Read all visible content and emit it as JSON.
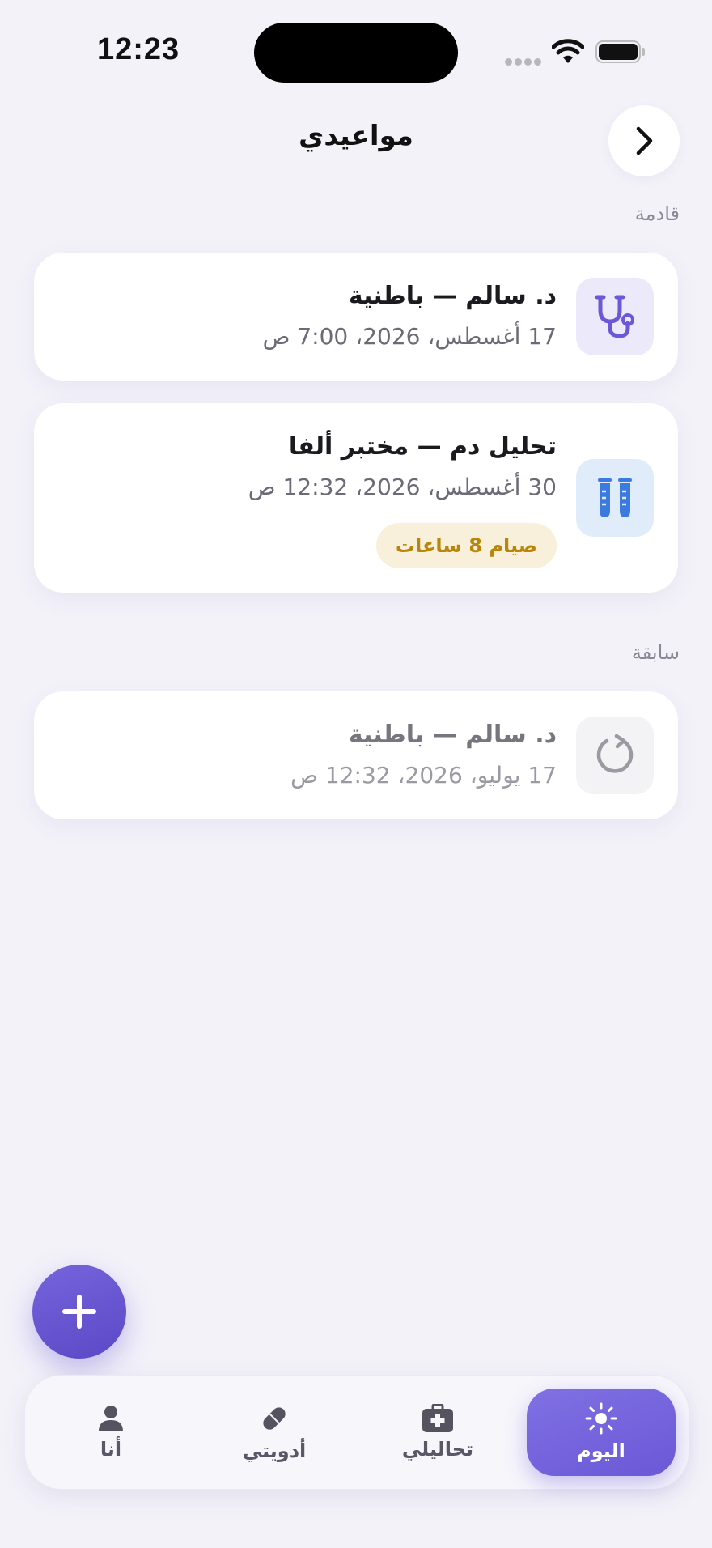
{
  "status_bar": {
    "time": "12:23"
  },
  "header": {
    "title": "مواعيدي"
  },
  "sections": {
    "upcoming_label": "قادمة",
    "past_label": "سابقة"
  },
  "appointments": {
    "upcoming": [
      {
        "title": "د. سالم — باطنية",
        "datetime": "17 أغسطس، 2026، 7:00 ص",
        "icon": "stethoscope-icon"
      },
      {
        "title": "تحليل دم — مختبر ألفا",
        "datetime": "30 أغسطس، 2026، 12:32 ص",
        "icon": "test-tubes-icon",
        "badge": "صيام 8 ساعات"
      }
    ],
    "past": [
      {
        "title": "د. سالم — باطنية",
        "datetime": "17 يوليو، 2026، 12:32 ص",
        "icon": "refresh-icon"
      }
    ]
  },
  "tabbar": {
    "tabs": [
      {
        "label": "اليوم",
        "icon": "sun-icon",
        "active": true
      },
      {
        "label": "تحاليلي",
        "icon": "medical-kit-icon",
        "active": false
      },
      {
        "label": "أدويتي",
        "icon": "pill-icon",
        "active": false
      },
      {
        "label": "أنا",
        "icon": "person-icon",
        "active": false
      }
    ]
  },
  "colors": {
    "accent": "#6a58d6",
    "background": "#f3f2f9",
    "badge_text": "#b8860b",
    "badge_bg": "#f8f0db"
  }
}
